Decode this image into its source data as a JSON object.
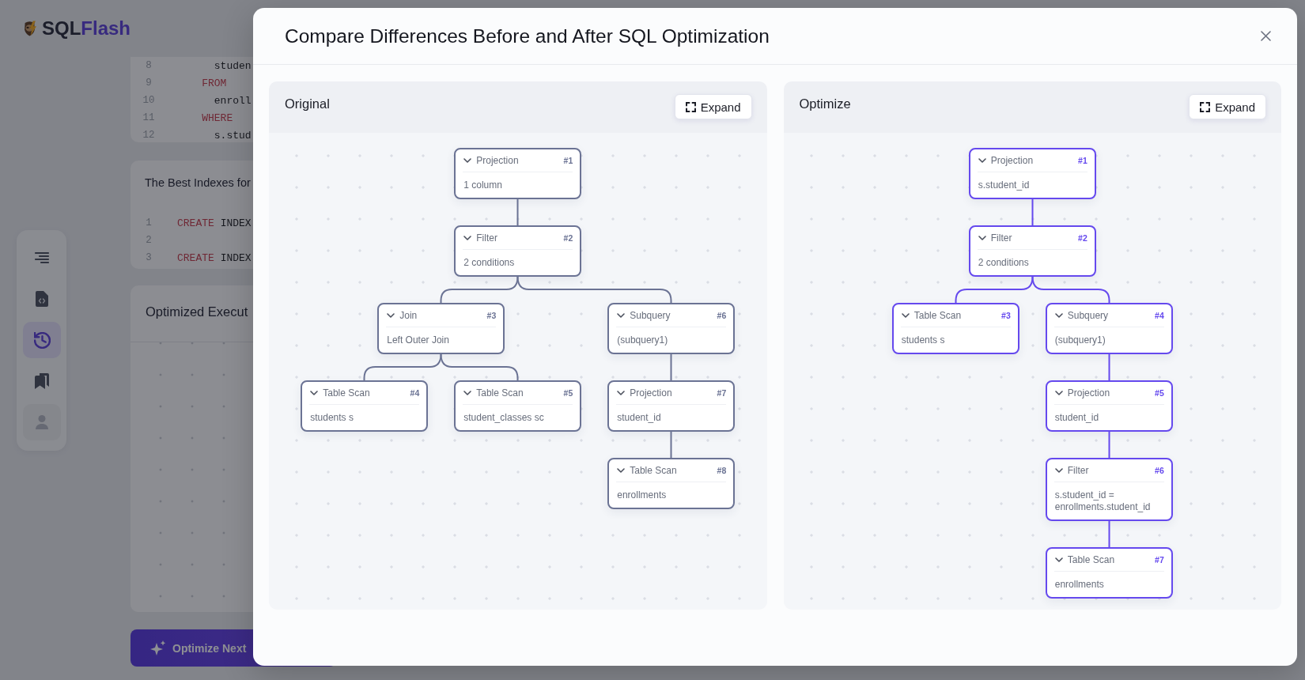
{
  "app": {
    "logo": {
      "part_1": "SQL",
      "part_2": "Flash"
    },
    "sidebar": {
      "items": [
        {
          "selected": false
        },
        {
          "selected": false
        },
        {
          "selected": true
        },
        {
          "selected": false
        }
      ]
    },
    "code_editor": {
      "lines": [
        {
          "number": "8",
          "tokens": [
            {
              "kind": "identifier",
              "text": "      studen"
            }
          ]
        },
        {
          "number": "9",
          "tokens": [
            {
              "kind": "keyword",
              "text": "    FROM"
            }
          ]
        },
        {
          "number": "10",
          "tokens": [
            {
              "kind": "identifier",
              "text": "      enroll"
            }
          ]
        },
        {
          "number": "11",
          "tokens": [
            {
              "kind": "keyword",
              "text": "    WHERE"
            }
          ]
        },
        {
          "number": "12",
          "tokens": [
            {
              "kind": "identifier",
              "text": "      s.stud"
            }
          ]
        }
      ]
    },
    "indexes_card": {
      "title": "The Best Indexes for",
      "lines": [
        {
          "number": "1",
          "tokens": [
            {
              "kind": "keyword",
              "text": "CREATE"
            },
            {
              "kind": "identifier",
              "text": "INDEX"
            }
          ]
        },
        {
          "number": "2"
        },
        {
          "number": "3",
          "tokens": [
            {
              "kind": "keyword",
              "text": "CREATE"
            },
            {
              "kind": "identifier",
              "text": "INDEX"
            }
          ]
        }
      ]
    },
    "execution_plan_card": {
      "title": "Optimized Execut"
    },
    "optimize_button": {
      "label": "Optimize Next"
    }
  },
  "dialog": {
    "title": "Compare Differences Before and After SQL Optimization",
    "panels": [
      {
        "title": "Original",
        "color": "#6b7394",
        "expand_button": "Expand",
        "plan": {
          "operator": "Projection",
          "number": "#1",
          "detail": "1 column",
          "expanded": true,
          "children": [
            {
              "operator": "Filter",
              "number": "#2",
              "detail": "2 conditions",
              "expanded": true,
              "children": [
                {
                  "operator": "Join",
                  "number": "#3",
                  "detail": "Left Outer Join",
                  "expanded": true,
                  "children": [
                    {
                      "operator": "Table Scan",
                      "number": "#4",
                      "detail": "students s",
                      "expanded": true
                    },
                    {
                      "operator": "Table Scan",
                      "number": "#5",
                      "detail": "student_classes sc",
                      "expanded": true
                    }
                  ]
                },
                {
                  "operator": "Subquery",
                  "number": "#6",
                  "detail": "(subquery1)",
                  "expanded": true,
                  "children": [
                    {
                      "operator": "Projection",
                      "number": "#7",
                      "detail": "student_id",
                      "expanded": true,
                      "children": [
                        {
                          "operator": "Table Scan",
                          "number": "#8",
                          "detail": "enrollments",
                          "expanded": true
                        }
                      ]
                    }
                  ]
                }
              ]
            }
          ]
        }
      },
      {
        "title": "Optimize",
        "color": "#6549ee",
        "expand_button": "Expand",
        "plan": {
          "operator": "Projection",
          "number": "#1",
          "detail": "s.student_id",
          "expanded": true,
          "children": [
            {
              "operator": "Filter",
              "number": "#2",
              "detail": "2 conditions",
              "expanded": true,
              "children": [
                {
                  "operator": "Table Scan",
                  "number": "#3",
                  "detail": "students s",
                  "expanded": true
                },
                {
                  "operator": "Subquery",
                  "number": "#4",
                  "detail": "(subquery1)",
                  "expanded": true,
                  "children": [
                    {
                      "operator": "Projection",
                      "number": "#5",
                      "detail": "student_id",
                      "expanded": true,
                      "children": [
                        {
                          "operator": "Filter",
                          "number": "#6",
                          "detail": "s.student_id = enrollments.student_id",
                          "expanded": true,
                          "children": [
                            {
                              "operator": "Table Scan",
                              "number": "#7",
                              "detail": "enrollments",
                              "expanded": true
                            }
                          ]
                        }
                      ]
                    }
                  ]
                }
              ]
            }
          ]
        }
      }
    ]
  }
}
